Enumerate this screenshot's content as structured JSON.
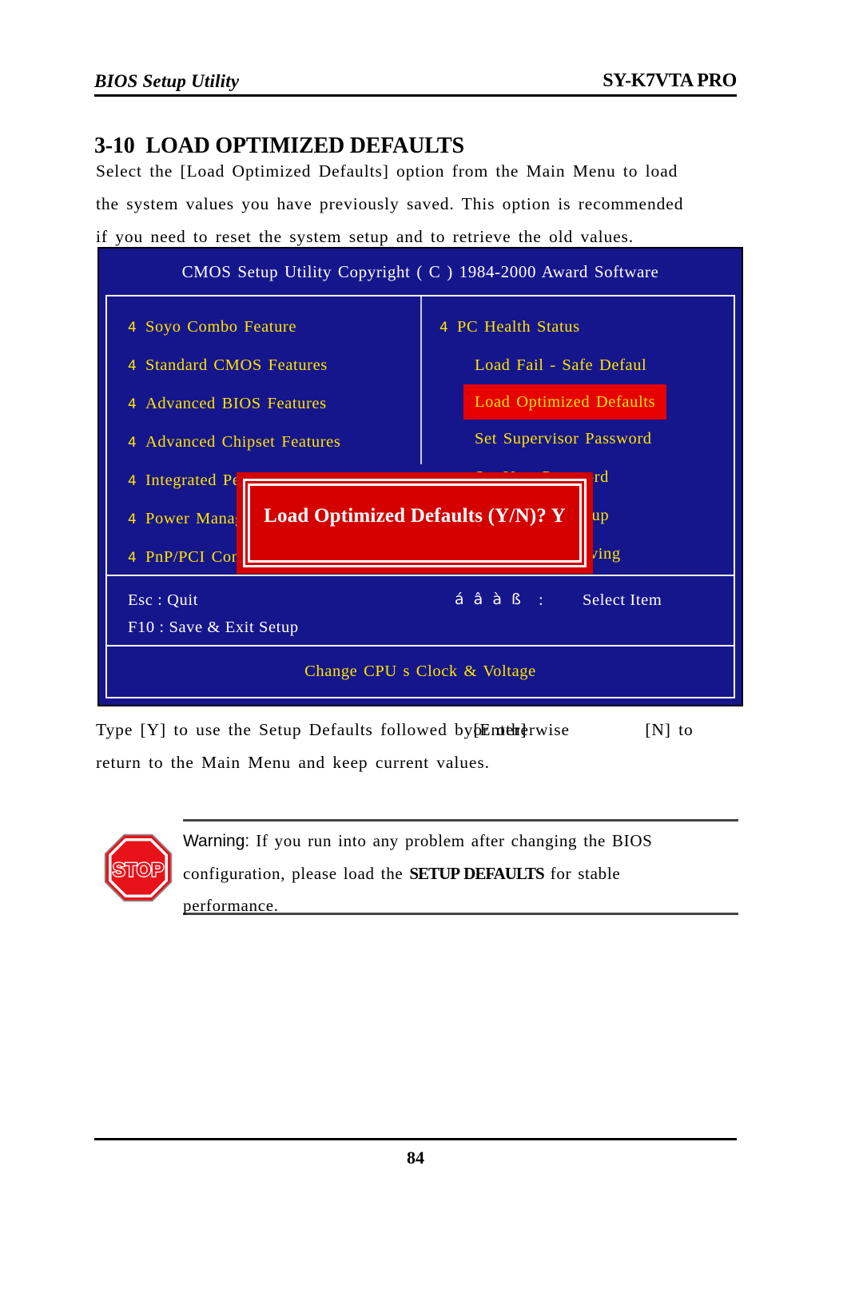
{
  "header": {
    "left_title": "BIOS Setup Utility",
    "right_title": "SY-K7VTA PRO"
  },
  "section": {
    "number": "3-10",
    "title": "LOAD OPTIMIZED DEFAULTS"
  },
  "intro_paragraph": {
    "line1": "Select the [Load Optimized Defaults] option from the Main Menu to load",
    "line2": "the system values you have previously saved. This option is recommended",
    "line3": "if you need to reset the system setup and to retrieve the old values."
  },
  "bios_screen": {
    "title": "CMOS Setup Utility Copyright ( C ) 1984-2000 Award Software",
    "left_menu": [
      {
        "marker": "4",
        "label": "Soyo Combo Feature"
      },
      {
        "marker": "4",
        "label": "Standard CMOS Features"
      },
      {
        "marker": "4",
        "label": "Advanced BIOS Features"
      },
      {
        "marker": "4",
        "label": "Advanced Chipset Features"
      },
      {
        "marker": "4",
        "label": "Integrated Peripherals"
      },
      {
        "marker": "4",
        "label": "Power Management Setup"
      },
      {
        "marker": "4",
        "label": "PnP/PCI Configurations"
      }
    ],
    "right_menu": [
      {
        "marker": "4",
        "label": "PC Health Status",
        "highlighted": false
      },
      {
        "marker": "",
        "label": "Load Fail - Safe Defaul",
        "highlighted": false
      },
      {
        "marker": "",
        "label": "Load Optimized Defaults",
        "highlighted": true
      },
      {
        "marker": "",
        "label": "Set Supervisor Password",
        "highlighted": false
      },
      {
        "marker": "",
        "label": "Set User Password",
        "highlighted": false
      },
      {
        "marker": "",
        "label": "Save & Exit Setup",
        "highlighted": false
      },
      {
        "marker": "",
        "label": "Exit Without Saving",
        "highlighted": false
      }
    ],
    "help": {
      "esc": "Esc : Quit",
      "f10": "F10 : Save & Exit Setup",
      "arrows": "á â à ß",
      "colon": ":",
      "select": "Select Item"
    },
    "hint": "Change CPU s Clock & Voltage",
    "colors": {
      "background": "#16168c",
      "menu_text": "#ffe400",
      "help_text": "#ffffff",
      "highlight_background": "#e60000",
      "dialog_background": "#d40000"
    }
  },
  "dialog": {
    "message": "Load Optimized Defaults (Y/N)? Y"
  },
  "type_paragraph": {
    "line1_a": "Type [Y] to use the Setup Defaults followed by",
    "line1_overlap_1": "[Enter]",
    "line1_overlap_2": "or otherwise",
    "line1_b": "[N] to",
    "line2": "return to the Main Menu and keep current values."
  },
  "warning": {
    "label": "Warning:",
    "line1": "If you run into any problem after changing the BIOS",
    "line2_before": "configuration, please load the ",
    "line2_strong": "SETUP DEFAULTS",
    "line2_after": " for stable",
    "line3": "performance.",
    "icon_label": "STOP",
    "icon_color": "#e8121a"
  },
  "footer": {
    "page_number": "84"
  }
}
